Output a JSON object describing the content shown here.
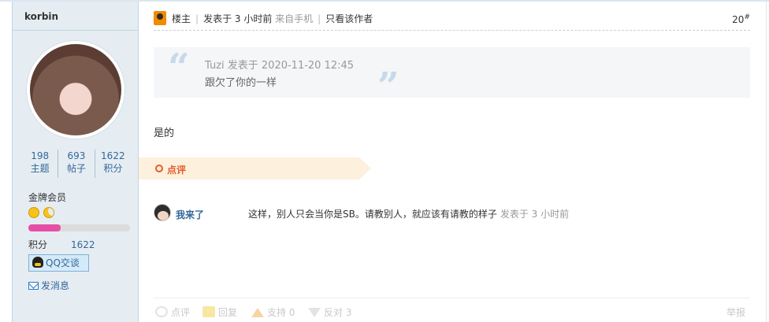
{
  "user": {
    "name": "korbin",
    "stats": [
      {
        "value": "198",
        "label": "主题"
      },
      {
        "value": "693",
        "label": "帖子"
      },
      {
        "value": "1622",
        "label": "积分"
      }
    ],
    "rank": "金牌会员",
    "level_progress": 0.32,
    "credit_label": "积分",
    "credit_value": "1622",
    "qq_button": "QQ交谈",
    "message_link": "发消息"
  },
  "post": {
    "author_role": "楼主",
    "time": "发表于 3 小时前",
    "source": "来自手机",
    "only_author": "只看该作者",
    "floor": "20",
    "floor_sup": "#",
    "quote": {
      "meta": "Tuzi 发表于 2020-11-20 12:45",
      "text": "跟欠了你的一样"
    },
    "body": "是的",
    "review_label": "点评"
  },
  "comment": {
    "user": "我来了",
    "text": "这样，别人只会当你是SB。请教别人，就应该有请教的样子",
    "time": "发表于 3 小时前"
  },
  "actions": {
    "review": "点评",
    "reply": "回复",
    "support": "支持 0",
    "oppose": "反对 3",
    "report": "举报"
  },
  "colors": {
    "link": "#336699",
    "accent_orange": "#e35d2e",
    "sidebar_bg": "#e5edf2",
    "progress": "#e64fa6"
  }
}
